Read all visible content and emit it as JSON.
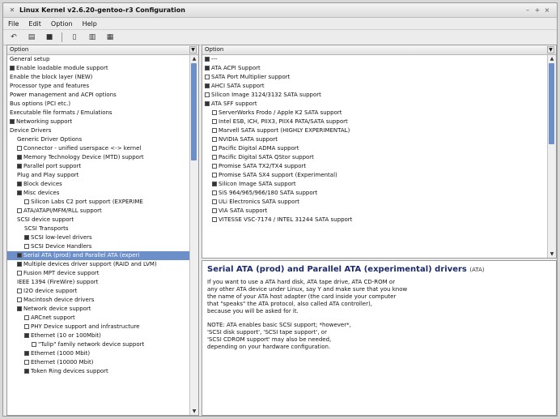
{
  "window": {
    "title": "Linux Kernel v2.6.20-gentoo-r3 Configuration"
  },
  "menu": {
    "file": "File",
    "edit": "Edit",
    "option": "Option",
    "help": "Help"
  },
  "left_pane": {
    "header": "Option",
    "items": [
      {
        "label": "General setup",
        "indent": 0,
        "exp": "",
        "mark": ""
      },
      {
        "label": "Enable loadable module support",
        "indent": 0,
        "exp": "",
        "mark": "on"
      },
      {
        "label": "Enable the block layer (NEW)",
        "indent": 0,
        "exp": "",
        "mark": ""
      },
      {
        "label": "Processor type and features",
        "indent": 0,
        "exp": "",
        "mark": ""
      },
      {
        "label": "Power management and ACPI options",
        "indent": 0,
        "exp": "",
        "mark": ""
      },
      {
        "label": "Bus options (PCI etc.)",
        "indent": 0,
        "exp": "",
        "mark": ""
      },
      {
        "label": "Executable file formats / Emulations",
        "indent": 0,
        "exp": "",
        "mark": ""
      },
      {
        "label": "Networking support",
        "indent": 0,
        "exp": "",
        "mark": "on"
      },
      {
        "label": "Device Drivers",
        "indent": 0,
        "exp": "",
        "mark": ""
      },
      {
        "label": "Generic Driver Options",
        "indent": 1,
        "exp": "",
        "mark": ""
      },
      {
        "label": "Connector - unified userspace <-> kernel",
        "indent": 1,
        "exp": "",
        "mark": "off"
      },
      {
        "label": "Memory Technology Device (MTD) support",
        "indent": 1,
        "exp": "",
        "mark": "on"
      },
      {
        "label": "Parallel port support",
        "indent": 1,
        "exp": "",
        "mark": "on"
      },
      {
        "label": "Plug and Play support",
        "indent": 1,
        "exp": "",
        "mark": ""
      },
      {
        "label": "Block devices",
        "indent": 1,
        "exp": "",
        "mark": "on"
      },
      {
        "label": "Misc devices",
        "indent": 1,
        "exp": "",
        "mark": "on"
      },
      {
        "label": "Silicon Labs C2 port support (EXPERIME",
        "indent": 2,
        "exp": "",
        "mark": "off"
      },
      {
        "label": "ATA/ATAPI/MFM/RLL support",
        "indent": 1,
        "exp": "",
        "mark": "off"
      },
      {
        "label": "SCSI device support",
        "indent": 1,
        "exp": "",
        "mark": ""
      },
      {
        "label": "SCSI Transports",
        "indent": 2,
        "exp": "",
        "mark": ""
      },
      {
        "label": "SCSI low-level drivers",
        "indent": 2,
        "exp": "",
        "mark": "on"
      },
      {
        "label": "SCSI Device Handlers",
        "indent": 2,
        "exp": "",
        "mark": "off"
      },
      {
        "label": "Serial ATA (prod) and Parallel ATA (experi",
        "indent": 1,
        "exp": "",
        "mark": "on",
        "selected": true
      },
      {
        "label": "Multiple devices driver support (RAID and LVM)",
        "indent": 1,
        "exp": "",
        "mark": "on"
      },
      {
        "label": "Fusion MPT device support",
        "indent": 1,
        "exp": "",
        "mark": "off"
      },
      {
        "label": "IEEE 1394 (FireWire) support",
        "indent": 1,
        "exp": "",
        "mark": ""
      },
      {
        "label": "I2O device support",
        "indent": 1,
        "exp": "",
        "mark": "off"
      },
      {
        "label": "Macintosh device drivers",
        "indent": 1,
        "exp": "",
        "mark": "off"
      },
      {
        "label": "Network device support",
        "indent": 1,
        "exp": "",
        "mark": "on"
      },
      {
        "label": "ARCnet support",
        "indent": 2,
        "exp": "",
        "mark": "off"
      },
      {
        "label": "PHY Device support and infrastructure",
        "indent": 2,
        "exp": "",
        "mark": "off"
      },
      {
        "label": "Ethernet (10 or 100Mbit)",
        "indent": 2,
        "exp": "",
        "mark": "on"
      },
      {
        "label": "\"Tulip\" family network device support",
        "indent": 3,
        "exp": "",
        "mark": "off"
      },
      {
        "label": "Ethernet (1000 Mbit)",
        "indent": 2,
        "exp": "",
        "mark": "on"
      },
      {
        "label": "Ethernet (10000 Mbit)",
        "indent": 2,
        "exp": "",
        "mark": "off"
      },
      {
        "label": "Token Ring devices support",
        "indent": 2,
        "exp": "",
        "mark": "on"
      }
    ]
  },
  "right_pane": {
    "header": "Option",
    "items": [
      {
        "label": "---",
        "indent": 0,
        "mark": "on"
      },
      {
        "label": "ATA ACPI Support",
        "indent": 0,
        "mark": "on"
      },
      {
        "label": "SATA Port Multiplier support",
        "indent": 0,
        "mark": "off"
      },
      {
        "label": "AHCI SATA support",
        "indent": 0,
        "mark": "on"
      },
      {
        "label": "Silicon Image 3124/3132 SATA support",
        "indent": 0,
        "mark": "off"
      },
      {
        "label": "ATA SFF support",
        "indent": 0,
        "mark": "on"
      },
      {
        "label": "ServerWorks Frodo / Apple K2 SATA support",
        "indent": 1,
        "mark": "off"
      },
      {
        "label": "Intel ESB, ICH, PIIX3, PIIX4 PATA/SATA support",
        "indent": 1,
        "mark": "off"
      },
      {
        "label": "Marvell SATA support (HIGHLY EXPERIMENTAL)",
        "indent": 1,
        "mark": "off"
      },
      {
        "label": "NVIDIA SATA support",
        "indent": 1,
        "mark": "off"
      },
      {
        "label": "Pacific Digital ADMA support",
        "indent": 1,
        "mark": "off"
      },
      {
        "label": "Pacific Digital SATA QStor support",
        "indent": 1,
        "mark": "off"
      },
      {
        "label": "Promise SATA TX2/TX4 support",
        "indent": 1,
        "mark": "off"
      },
      {
        "label": "Promise SATA SX4 support (Experimental)",
        "indent": 1,
        "mark": "off"
      },
      {
        "label": "Silicon Image SATA support",
        "indent": 1,
        "mark": "on"
      },
      {
        "label": "SiS 964/965/966/180 SATA support",
        "indent": 1,
        "mark": "off"
      },
      {
        "label": "ULi Electronics SATA support",
        "indent": 1,
        "mark": "off"
      },
      {
        "label": "VIA SATA support",
        "indent": 1,
        "mark": "off"
      },
      {
        "label": "VITESSE VSC-7174 / INTEL 31244 SATA support",
        "indent": 1,
        "mark": "off"
      }
    ]
  },
  "help": {
    "title": "Serial ATA (prod) and Parallel ATA (experimental) drivers",
    "symbol": "(ATA)",
    "para1": "If you want to use a ATA hard disk, ATA tape drive, ATA CD-ROM or\nany other ATA device under Linux, say Y and make sure that you know\nthe name of your ATA host adapter (the card inside your computer\nthat \"speaks\" the ATA protocol, also called ATA controller),\nbecause you will be asked for it.",
    "para2": "NOTE: ATA enables basic SCSI support; *however*,\n'SCSI disk support', 'SCSI tape support', or\n'SCSI CDROM support' may also be needed,\ndepending on your hardware configuration."
  }
}
